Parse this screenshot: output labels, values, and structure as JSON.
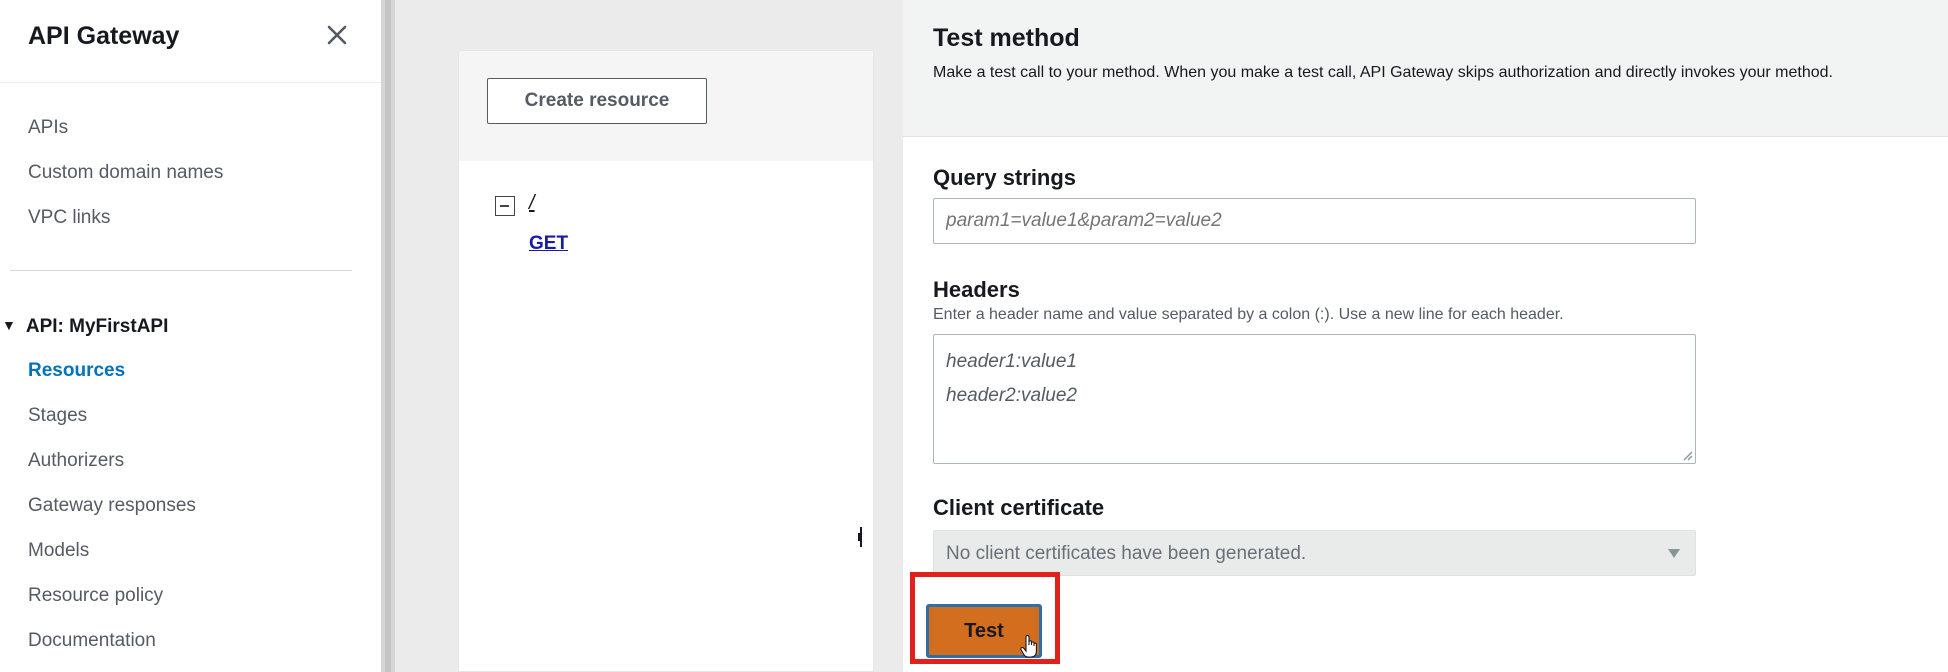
{
  "sidebar": {
    "title": "API Gateway",
    "top_links": [
      "APIs",
      "Custom domain names",
      "VPC links"
    ],
    "api_section": "API: MyFirstAPI",
    "api_links": [
      "Resources",
      "Stages",
      "Authorizers",
      "Gateway responses",
      "Models",
      "Resource policy",
      "Documentation"
    ],
    "active_link": "Resources"
  },
  "resources": {
    "create_label": "Create resource",
    "root_path": "/",
    "method": "GET"
  },
  "test_method": {
    "title": "Test method",
    "description": "Make a test call to your method. When you make a test call, API Gateway skips authorization and directly invokes your method.",
    "query_strings_label": "Query strings",
    "query_strings_placeholder": "param1=value1&param2=value2",
    "headers_label": "Headers",
    "headers_hint": "Enter a header name and value separated by a colon (:). Use a new line for each header.",
    "headers_placeholder": [
      "header1:value1",
      "header2:value2"
    ],
    "client_cert_label": "Client certificate",
    "client_cert_value": "No client certificates have been generated.",
    "test_label": "Test"
  },
  "icons": {
    "close": "close-icon",
    "expand": "caret-down-icon",
    "collapse": "collapse-box-icon",
    "dropdown": "chevron-down-icon",
    "pointer": "hand-pointer-icon"
  },
  "colors": {
    "accent_link": "#0073bb",
    "method_link": "#1a1aa8",
    "primary_button": "#d46e1f",
    "highlight": "#e0211e"
  }
}
